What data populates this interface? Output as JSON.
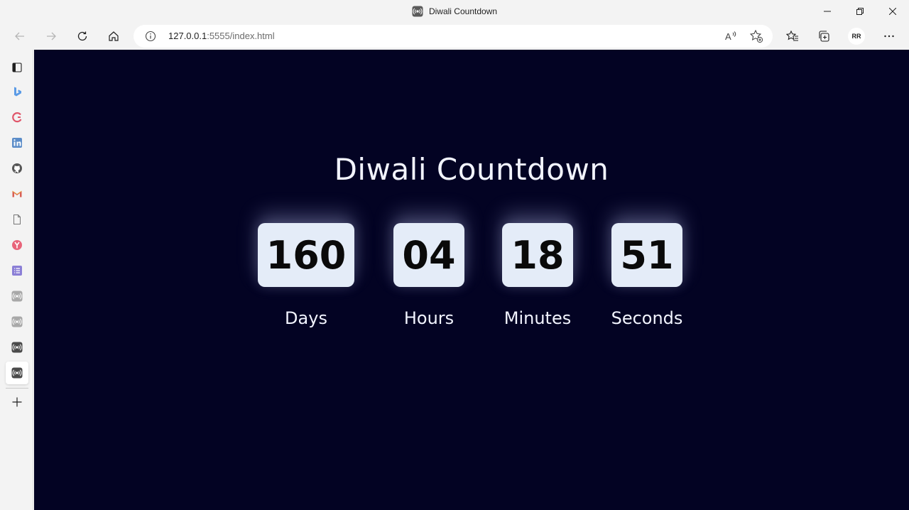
{
  "window": {
    "title": "Diwali Countdown"
  },
  "toolbar": {
    "url_host": "127.0.0.1",
    "url_rest": ":5555/index.html",
    "avatar_initials": "RR"
  },
  "sidebar": {
    "items": [
      {
        "icon": "tab-actions-icon"
      },
      {
        "icon": "bing-icon"
      },
      {
        "icon": "search-app-icon"
      },
      {
        "icon": "linkedin-icon"
      },
      {
        "icon": "github-icon"
      },
      {
        "icon": "gmail-icon"
      },
      {
        "icon": "document-icon"
      },
      {
        "icon": "y-app-icon"
      },
      {
        "icon": "list-app-icon"
      },
      {
        "icon": "broadcast-icon"
      },
      {
        "icon": "broadcast-icon"
      },
      {
        "icon": "broadcast-icon"
      },
      {
        "icon": "broadcast-icon"
      }
    ],
    "add_icon": "plus-icon"
  },
  "countdown": {
    "heading": "Diwali Countdown",
    "units": [
      {
        "value": "160",
        "label": "Days"
      },
      {
        "value": "04",
        "label": "Hours"
      },
      {
        "value": "18",
        "label": "Minutes"
      },
      {
        "value": "51",
        "label": "Seconds"
      }
    ]
  },
  "colors": {
    "page_background": "#030323",
    "box_background": "#e4ecf8",
    "text_light": "#f2f4ff"
  }
}
